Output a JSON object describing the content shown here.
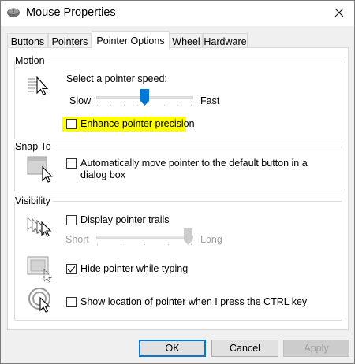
{
  "window": {
    "title": "Mouse Properties",
    "icon": "mouse-icon",
    "close_glyph": "✕"
  },
  "tabs": [
    {
      "label": "Buttons",
      "active": false
    },
    {
      "label": "Pointers",
      "active": false
    },
    {
      "label": "Pointer Options",
      "active": true
    },
    {
      "label": "Wheel",
      "active": false
    },
    {
      "label": "Hardware",
      "active": false
    }
  ],
  "motion": {
    "group_label": "Motion",
    "speed_label": "Select a pointer speed:",
    "slow_label": "Slow",
    "fast_label": "Fast",
    "speed_value_fraction": 0.5,
    "precision_label": "Enhance pointer precision",
    "precision_checked": false,
    "highlight_color": "#ffff00",
    "icon": "pointer-speed-icon"
  },
  "snap_to": {
    "group_label": "Snap To",
    "snap_label_line1": "Automatically move pointer to the default button in a",
    "snap_label_line2": "dialog box",
    "snap_checked": false,
    "icon": "snap-to-icon"
  },
  "visibility": {
    "group_label": "Visibility",
    "trails_label": "Display pointer trails",
    "trails_checked": false,
    "short_label": "Short",
    "long_label": "Long",
    "trails_value_fraction": 1.0,
    "hide_label": "Hide pointer while typing",
    "hide_checked": true,
    "show_location_label": "Show location of pointer when I press the CTRL key",
    "show_location_checked": false,
    "icons": [
      "pointer-trails-icon",
      "hide-pointer-icon",
      "show-location-icon"
    ]
  },
  "buttons": {
    "ok": "OK",
    "cancel": "Cancel",
    "apply": "Apply"
  },
  "colors": {
    "accent": "#0078d7",
    "highlight": "#ffff00"
  }
}
